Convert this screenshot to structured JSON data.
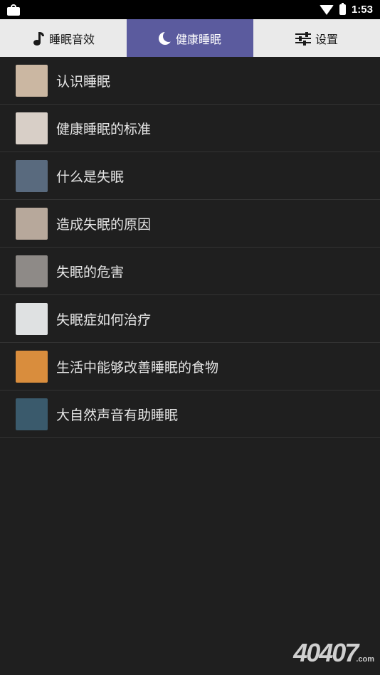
{
  "status_bar": {
    "time": "1:53"
  },
  "tabs": [
    {
      "label": "睡眠音效",
      "icon": "music-note-icon",
      "active": false
    },
    {
      "label": "健康睡眠",
      "icon": "moon-icon",
      "active": true
    },
    {
      "label": "设置",
      "icon": "settings-sliders-icon",
      "active": false
    }
  ],
  "list": [
    {
      "title": "认识睡眠",
      "thumb_color": "#cbb7a2"
    },
    {
      "title": "健康睡眠的标准",
      "thumb_color": "#d8cfc7"
    },
    {
      "title": "什么是失眠",
      "thumb_color": "#596a7e"
    },
    {
      "title": "造成失眠的原因",
      "thumb_color": "#b7a89b"
    },
    {
      "title": "失眠的危害",
      "thumb_color": "#8e8a87"
    },
    {
      "title": "失眠症如何治疗",
      "thumb_color": "#dfe1e2"
    },
    {
      "title": "生活中能够改善睡眠的食物",
      "thumb_color": "#d98d3d"
    },
    {
      "title": "大自然声音有助睡眠",
      "thumb_color": "#3a5a6c"
    }
  ],
  "watermark": {
    "main": "40407",
    "suffix": ".com"
  },
  "colors": {
    "accent": "#5b5b9e",
    "background": "#1f1f1f",
    "tab_bg": "#eaeaea"
  }
}
